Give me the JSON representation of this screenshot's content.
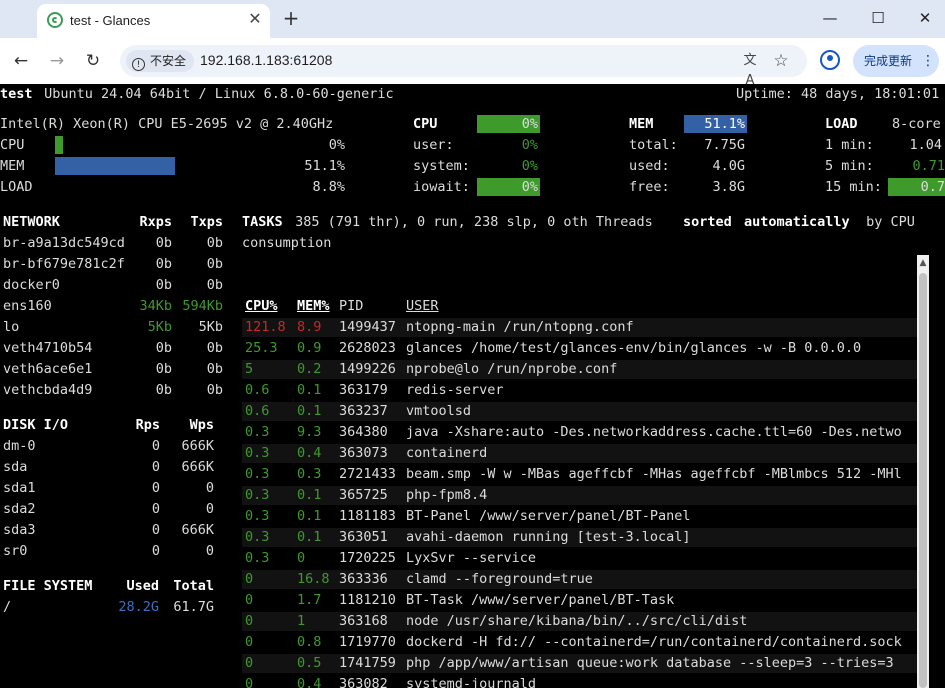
{
  "browser": {
    "tab_title": "test - Glances",
    "tab_close": "✕",
    "new_tab": "+",
    "win_min": "—",
    "win_max": "☐",
    "win_close": "✕",
    "back": "←",
    "forward": "→",
    "reload": "↻",
    "security_label": "不安全",
    "url": "192.168.1.183:61208",
    "translate_icon": "文A",
    "star": "☆",
    "update_label": "完成更新",
    "menu": "⋮"
  },
  "header": {
    "host": "test",
    "os": " Ubuntu 24.04 64bit / Linux 6.8.0-60-generic",
    "uptime": "Uptime: 48 days, 18:01:01"
  },
  "quicklook": {
    "cpu_name": "Intel(R) Xeon(R) CPU E5-2695 v2 @ 2.40GHz",
    "cpu_label": "CPU",
    "cpu_value": "0%",
    "cpu_fraction": 0.0,
    "mem_label": "MEM",
    "mem_value": "51.1%",
    "mem_fraction": 0.511,
    "load_label": "LOAD",
    "load_value": "8.8%",
    "load_fraction": 0.088
  },
  "cpu": {
    "title": "CPU",
    "total": "0%",
    "rows": [
      {
        "label": "user:",
        "value": "0%"
      },
      {
        "label": "system:",
        "value": "0%"
      },
      {
        "label": "iowait:",
        "value": "0%"
      }
    ]
  },
  "mem": {
    "title": "MEM",
    "total": "51.1%",
    "rows": [
      {
        "label": "total:",
        "value": "7.75G"
      },
      {
        "label": "used:",
        "value": "4.0G"
      },
      {
        "label": "free:",
        "value": "3.8G"
      }
    ]
  },
  "load": {
    "title": "LOAD",
    "cores": "8-core",
    "rows": [
      {
        "label": "1 min:",
        "value": "1.04"
      },
      {
        "label": "5 min:",
        "value": "0.71"
      },
      {
        "label": "15 min:",
        "value": "0.7"
      }
    ]
  },
  "network": {
    "headers": [
      "NETWORK",
      "Rxps",
      "Txps"
    ],
    "rows": [
      [
        "br-a9a13dc549cd",
        "0b",
        "0b"
      ],
      [
        "br-bf679e781c2f",
        "0b",
        "0b"
      ],
      [
        "docker0",
        "0b",
        "0b"
      ],
      [
        "ens160",
        "34Kb",
        "594Kb"
      ],
      [
        "lo",
        "5Kb",
        "5Kb"
      ],
      [
        "veth4710b54",
        "0b",
        "0b"
      ],
      [
        "veth6ace6e1",
        "0b",
        "0b"
      ],
      [
        "vethcbda4d9",
        "0b",
        "0b"
      ]
    ]
  },
  "diskio": {
    "headers": [
      "DISK I/O",
      "Rps",
      "Wps"
    ],
    "rows": [
      [
        "dm-0",
        "0",
        "666K"
      ],
      [
        "sda",
        "0",
        "666K"
      ],
      [
        "sda1",
        "0",
        "0"
      ],
      [
        "sda2",
        "0",
        "0"
      ],
      [
        "sda3",
        "0",
        "666K"
      ],
      [
        "sr0",
        "0",
        "0"
      ]
    ]
  },
  "filesystem": {
    "headers": [
      "FILE SYSTEM",
      "Used",
      "Total"
    ],
    "rows": [
      [
        "/",
        "28.2G",
        "61.7G"
      ]
    ]
  },
  "tasks": {
    "label": "TASKS",
    "summary": " 385 (791 thr), 0 run, 238 slp, 0 oth Threads ",
    "sorted": "sorted",
    "auto": "automatically",
    "by": " by CPU",
    "line2": "consumption"
  },
  "processes": {
    "headers": [
      "CPU%",
      "MEM%",
      "PID",
      "USER"
    ],
    "rows": [
      [
        "121.8",
        "8.9",
        "1499437",
        "ntopng-main /run/ntopng.conf"
      ],
      [
        "25.3",
        "0.9",
        "2628023",
        "glances /home/test/glances-env/bin/glances -w -B 0.0.0.0"
      ],
      [
        "5",
        "0.2",
        "1499226",
        "nprobe@lo /run/nprobe.conf"
      ],
      [
        "0.6",
        "0.1",
        "363179",
        "redis-server"
      ],
      [
        "0.6",
        "0.1",
        "363237",
        "vmtoolsd"
      ],
      [
        "0.3",
        "9.3",
        "364380",
        "java -Xshare:auto -Des.networkaddress.cache.ttl=60 -Des.netwo"
      ],
      [
        "0.3",
        "0.4",
        "363073",
        "containerd"
      ],
      [
        "0.3",
        "0.3",
        "2721433",
        "beam.smp -W w -MBas ageffcbf -MHas ageffcbf -MBlmbcs 512 -MHl"
      ],
      [
        "0.3",
        "0.1",
        "365725",
        "php-fpm8.4"
      ],
      [
        "0.3",
        "0.1",
        "1181183",
        "BT-Panel /www/server/panel/BT-Panel"
      ],
      [
        "0.3",
        "0.1",
        "363051",
        "avahi-daemon running [test-3.local]"
      ],
      [
        "0.3",
        "0",
        "1720225",
        "LyxSvr --service"
      ],
      [
        "0",
        "16.8",
        "363336",
        "clamd --foreground=true"
      ],
      [
        "0",
        "1.7",
        "1181210",
        "BT-Task /www/server/panel/BT-Task"
      ],
      [
        "0",
        "1",
        "363168",
        "node /usr/share/kibana/bin/../src/cli/dist"
      ],
      [
        "0",
        "0.8",
        "1719770",
        "dockerd -H fd:// --containerd=/run/containerd/containerd.sock"
      ],
      [
        "0",
        "0.5",
        "1741759",
        "php /app/www/artisan queue:work database --sleep=3 --tries=3"
      ],
      [
        "0",
        "0.4",
        "363082",
        "systemd-journald"
      ]
    ]
  },
  "colors": {
    "ok": "#3f9a2c",
    "critical": "#c62828",
    "mem_bar": "#3461a6"
  }
}
